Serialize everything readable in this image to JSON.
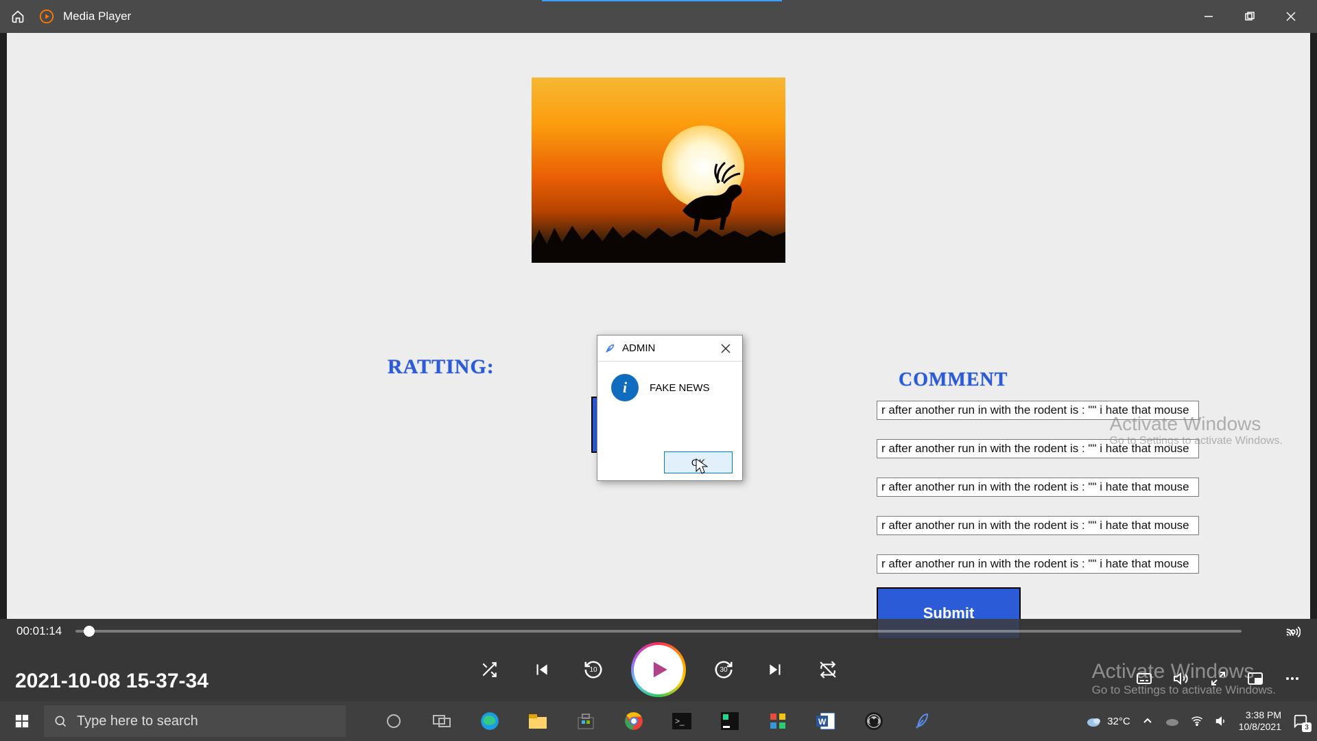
{
  "window": {
    "app_title": "Media Player"
  },
  "video_content": {
    "ratting_label": "RATTING:",
    "comment_label": "COMMENT",
    "comment_value": "r after another run in with the rodent is : \"\" i hate that mouse",
    "submit_label": "Submit",
    "watermark_title": "Activate Windows",
    "watermark_sub": "Go to Settings to activate Windows."
  },
  "dialog": {
    "title": "ADMIN",
    "message": "FAKE NEWS",
    "ok_label": "OK"
  },
  "player": {
    "timecode": "00:01:14",
    "file_title": "2021-10-08 15-37-34",
    "skip_back_label": "10",
    "skip_fwd_label": "30"
  },
  "overlay_watermark": {
    "title": "Activate Windows",
    "sub": "Go to Settings to activate Windows."
  },
  "taskbar": {
    "search_placeholder": "Type here to search",
    "weather_temp": "32°C",
    "clock_time": "3:38 PM",
    "clock_date": "10/8/2021",
    "notif_count": "3"
  }
}
